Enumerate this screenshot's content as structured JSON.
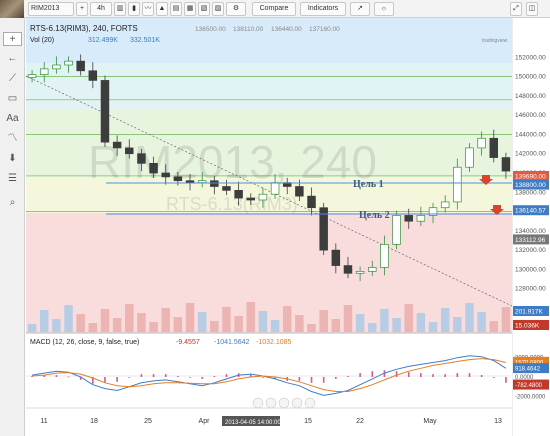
{
  "toolbar": {
    "symbol": "RIM2013",
    "interval": "4h",
    "compare_label": "Compare",
    "indicators_label": "Indicators"
  },
  "legend": {
    "title": "RTS-6.13(RIM3), 240, FORTS",
    "ohlc": [
      "136500.00",
      "138110.00",
      "136440.00",
      "137160.00"
    ],
    "vol_label": "Vol (20)",
    "vol_values": [
      "312.499K",
      "332.501K"
    ]
  },
  "watermark": {
    "main": "RIM2013, 240",
    "sub": "RTS-6.13(RIM3)"
  },
  "annotations": {
    "target1": "Цель 1",
    "target2": "Цель 2"
  },
  "macd": {
    "label": "MACD (12, 26, close, 9, false, true)",
    "values": [
      "-9.4557",
      "-1041.5642",
      "-1032.1085"
    ]
  },
  "chart_data": [
    {
      "type": "line",
      "name": "price",
      "x": [
        "11",
        "18",
        "25",
        "Apr",
        "8",
        "15",
        "22",
        "May",
        "13"
      ],
      "ylim": [
        126000,
        154000
      ],
      "y_ticks": [
        152000,
        150000,
        148000,
        146000,
        144000,
        142000,
        140000,
        138000,
        136000,
        134000,
        132000,
        130000,
        128000
      ],
      "series": [
        {
          "values": [
            150200,
            150800,
            151200,
            151600,
            150600,
            149600,
            143200,
            142600,
            142000,
            141000,
            140000,
            139600,
            139200,
            139000,
            139200,
            138600,
            138200,
            137400,
            137200,
            137800,
            139000,
            138600,
            137600,
            136400,
            132000,
            130400,
            129600,
            129800,
            130200,
            132600,
            135600,
            135000,
            135600,
            136400,
            137000,
            140600,
            142600,
            143600,
            141600,
            140200
          ]
        }
      ],
      "price_badges": [
        {
          "label": "139690.00",
          "color": "#e25b3f"
        },
        {
          "label": "138800.00",
          "color": "#3e7dc4"
        },
        {
          "label": "136140.57",
          "color": "#3e7dc4"
        },
        {
          "label": "133112.96",
          "color": "#777777"
        }
      ],
      "volume_badges": [
        {
          "label": "201.917K",
          "color": "#3e7dc4"
        },
        {
          "label": "15.036K",
          "color": "#c0392b"
        }
      ],
      "fib_levels": [
        150000,
        147600,
        144000,
        139700,
        136000
      ]
    },
    {
      "type": "line",
      "name": "macd",
      "ylim": [
        -3000,
        3000
      ],
      "y_ticks": [
        2000,
        0,
        -2000
      ],
      "y_tick_labels": [
        "2000.0000",
        "0.0000",
        "-2000.0000"
      ],
      "badges": [
        {
          "label": "1570.0800",
          "color": "#e67e22"
        },
        {
          "label": "918.4642",
          "color": "#3e7dc4"
        },
        {
          "label": "-782.4800",
          "color": "#c0392b"
        }
      ],
      "series": [
        {
          "name": "macd",
          "values": [
            200,
            400,
            600,
            500,
            0,
            -800,
            -1200,
            -1400,
            -1000,
            -600,
            -400,
            -300,
            -500,
            -700,
            -900,
            -600,
            -200,
            200,
            300,
            100,
            -200,
            -600,
            -900,
            -1500,
            -1900,
            -1700,
            -1400,
            -800,
            -200,
            400,
            800,
            1100,
            1300,
            1500,
            1700,
            2000,
            2200,
            2100,
            1700,
            900
          ]
        },
        {
          "name": "signal",
          "values": [
            100,
            200,
            400,
            450,
            300,
            -100,
            -600,
            -900,
            -1000,
            -900,
            -700,
            -600,
            -600,
            -650,
            -700,
            -700,
            -500,
            -200,
            0,
            100,
            0,
            -200,
            -500,
            -900,
            -1300,
            -1500,
            -1500,
            -1200,
            -800,
            -300,
            200,
            600,
            900,
            1200,
            1400,
            1600,
            1800,
            1900,
            1800,
            1500
          ]
        }
      ]
    }
  ],
  "time_axis": {
    "labels": [
      "11",
      "18",
      "25",
      "Apr",
      "8",
      "15",
      "22",
      "May",
      "13"
    ],
    "cursor_label": "2013-04-05 14:00:00"
  },
  "sidebar": {
    "tools": [
      "crosshair-icon",
      "arrow-icon",
      "trend-line-icon",
      "rectangle-icon",
      "text-icon",
      "curve-icon",
      "arrow-down-icon",
      "fib-icon",
      "zoom-icon"
    ]
  }
}
